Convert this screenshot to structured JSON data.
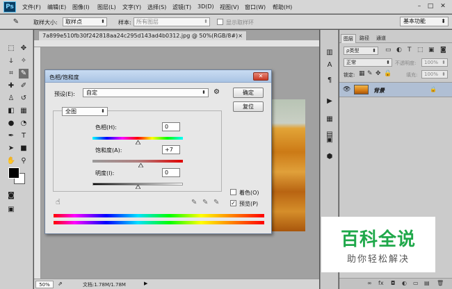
{
  "menubar": {
    "logo": "Ps",
    "items": [
      "文件(F)",
      "编辑(E)",
      "图像(I)",
      "图层(L)",
      "文字(Y)",
      "选择(S)",
      "滤镜(T)",
      "3D(D)",
      "视图(V)",
      "窗口(W)",
      "帮助(H)"
    ],
    "window_buttons": [
      "–",
      "□",
      "✕"
    ]
  },
  "options": {
    "sample_size_label": "取样大小:",
    "sample_size_value": "取样点",
    "sample_label": "样本:",
    "sample_value": "所有图层",
    "show_ring_label": "显示取样环",
    "workspace": "基本功能"
  },
  "document": {
    "tab_title": "7a899e510fb30f242818aa24c295d143ad4b0312.jpg @ 50%(RGB/8#)",
    "tab_close": "×",
    "zoom": "50%",
    "doc_size": "文档:1.78M/1.78M"
  },
  "dialog": {
    "title": "色相/饱和度",
    "close": "✕",
    "preset_label": "预设(E):",
    "preset_value": "自定",
    "ok": "确定",
    "reset": "复位",
    "channel_value": "全图",
    "hue_label": "色相(H):",
    "hue_value": "0",
    "saturation_label": "饱和度(A):",
    "saturation_value": "+7",
    "lightness_label": "明度(I):",
    "lightness_value": "0",
    "colorize_label": "着色(O)",
    "preview_label": "预览(P)",
    "colorize_checked": false,
    "preview_checked": true,
    "hue_level": 0,
    "saturation_level": 7,
    "lightness_level": 0,
    "slider_range": [
      -100,
      100
    ]
  },
  "layers": {
    "tabs": [
      "图层",
      "路径",
      "通道"
    ],
    "kind_label": "ρ类型",
    "blend_mode": "正常",
    "opacity_label": "不透明度:",
    "opacity_value": "100%",
    "lock_label": "锁定:",
    "fill_label": "填充:",
    "fill_value": "100%",
    "layer_name": "背景",
    "bottom_icons": [
      "∞",
      "fx",
      "◘",
      "◐",
      "▭",
      "▤",
      "🗑"
    ]
  },
  "watermark": {
    "title": "百科全说",
    "subtitle": "助你轻松解决"
  },
  "colors": {
    "accent_title": "#aac4e4",
    "close_red": "#c73a26",
    "watermark_green": "#1fa84a",
    "layer_selected": "#b0bfd4"
  }
}
